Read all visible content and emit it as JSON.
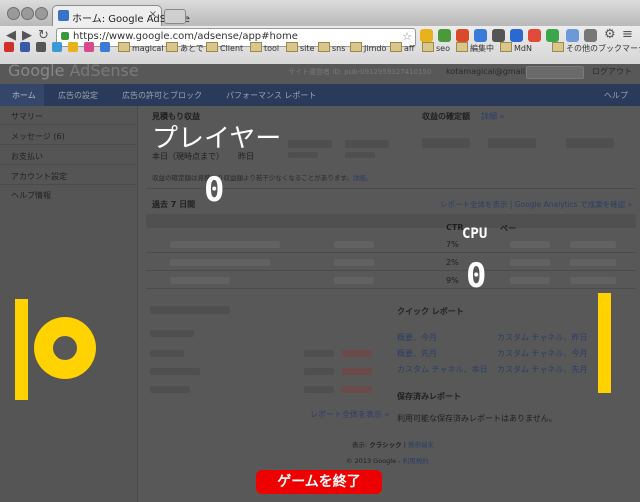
{
  "browser": {
    "tab_title": "ホーム: Google AdSense",
    "url": "https://www.google.com/adsense/app#home",
    "bookmarks": [
      "magical",
      "あとで",
      "Client",
      "tool",
      "site",
      "sns",
      "Jimdo",
      "aff",
      "seo",
      "編集中",
      "MdN",
      "その他のブックマーク"
    ]
  },
  "adsense": {
    "logo_google": "Google",
    "logo_adsense": "AdSense",
    "publisher_id": "サイト運営者 ID: pub-0912959327410150",
    "email": "kotamagical@gmail.com",
    "logout": "ログアウト",
    "nav": [
      "ホーム",
      "広告の設定",
      "広告の許可とブロック",
      "パフォーマンス レポート",
      "ヘルプ"
    ],
    "sidebar": [
      "サマリー",
      "メッセージ (6)",
      "お支払い",
      "アカウント設定",
      "ヘルプ情報"
    ],
    "estimated_title": "見積もり収益",
    "today": "本日（現時点まで）",
    "yesterday": "昨日",
    "finalized_title": "収益の確定額",
    "finalized_detail": "詳細 »",
    "note": "収益の確定額は見積もり収益額より若干少なくなることがあります。",
    "note_link": "詳細。",
    "last7": "過去 7 日間",
    "report_links": "レポート全体を表示 | Google Analytics で成果を確認 »",
    "ctr_head": "CTR",
    "page_head": "ペー",
    "ctr_values": [
      "7%",
      "2%",
      "9%"
    ],
    "quick_report": "クイック レポート",
    "quick_links_left": [
      "概要、今月",
      "概要、先月",
      "カスタム チャネル、本日"
    ],
    "quick_links_right": [
      "カスタム チャネル、昨日",
      "カスタム チャネル、今月",
      "カスタム チャネル、先月"
    ],
    "saved_title": "保存済みレポート",
    "saved_none": "利用可能な保存済みレポートはありません。",
    "report_all": "レポート全体を表示 »",
    "display_label": "表示:",
    "display_classic": "クラシック",
    "display_mobile": "携帯端末",
    "copyright": "© 2013 Google -",
    "terms": "利用規約"
  },
  "game": {
    "player_label": "プレイヤー",
    "player_score": "0",
    "cpu_label": "CPU",
    "cpu_score": "0",
    "end_button": "ゲームを終了",
    "accent_color": "#ffd200",
    "end_button_color": "#ee0000"
  }
}
